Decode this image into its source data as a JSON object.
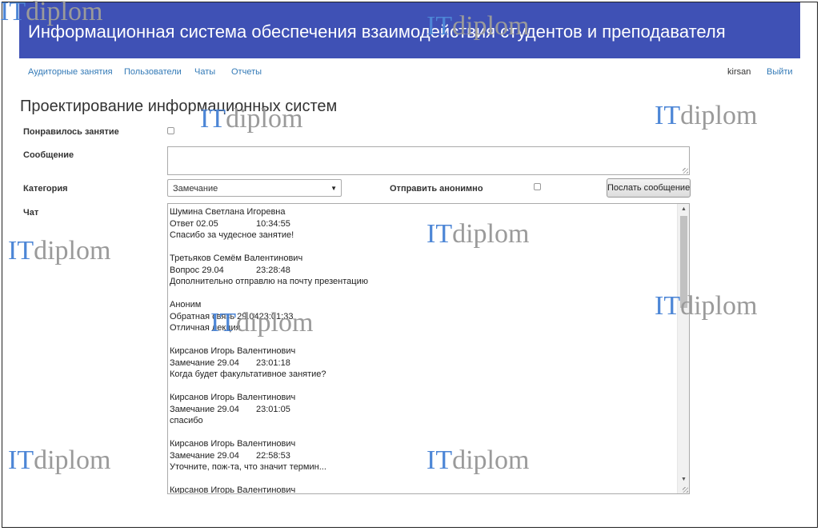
{
  "header": {
    "title": "Информационная система обеспечения взаимодействия студентов и преподавателя"
  },
  "nav": {
    "items": [
      {
        "label": "Аудиторные занятия"
      },
      {
        "label": "Пользователи"
      },
      {
        "label": "Чаты"
      },
      {
        "label": "Отчеты"
      }
    ],
    "user": "kirsan",
    "logout": "Выйти"
  },
  "page": {
    "title": "Проектирование информационных систем"
  },
  "form": {
    "liked_label": "Понравилось занятие",
    "liked_checked": false,
    "message_label": "Сообщение",
    "message_value": "",
    "category_label": "Категория",
    "category_value": "Замечание",
    "anonymous_label": "Отправить анонимно",
    "anonymous_checked": false,
    "send_button": "Послать сообщение",
    "chat_label": "Чат"
  },
  "chat": {
    "messages": [
      {
        "author": "Шумина Светлана Игоревна",
        "type": "Ответ 02.05",
        "time": "10:34:55",
        "text": "Спасибо за чудесное занятие!"
      },
      {
        "author": "Третьяков Семём Валентинович",
        "type": "Вопрос 29.04",
        "time": "23:28:48",
        "text": "Дополнительно отправлю на почту презентацию"
      },
      {
        "author": "Аноним",
        "type": "Обратная связь 29.04",
        "time": "23:01:33",
        "text": "Отличная лекция"
      },
      {
        "author": "Кирсанов Игорь Валентинович",
        "type": "Замечание 29.04",
        "time": "23:01:18",
        "text": "Когда будет факультативное занятие?"
      },
      {
        "author": "Кирсанов Игорь Валентинович",
        "type": "Замечание 29.04",
        "time": "23:01:05",
        "text": "спасибо"
      },
      {
        "author": "Кирсанов Игорь Валентинович",
        "type": "Замечание 29.04",
        "time": "22:58:53",
        "text": "Уточните, пож-та, что значит термин..."
      },
      {
        "author": "Кирсанов Игорь Валентинович",
        "type": "",
        "time": "",
        "text": ""
      }
    ]
  },
  "watermark": {
    "part1": "IT",
    "part2": "diplom"
  }
}
